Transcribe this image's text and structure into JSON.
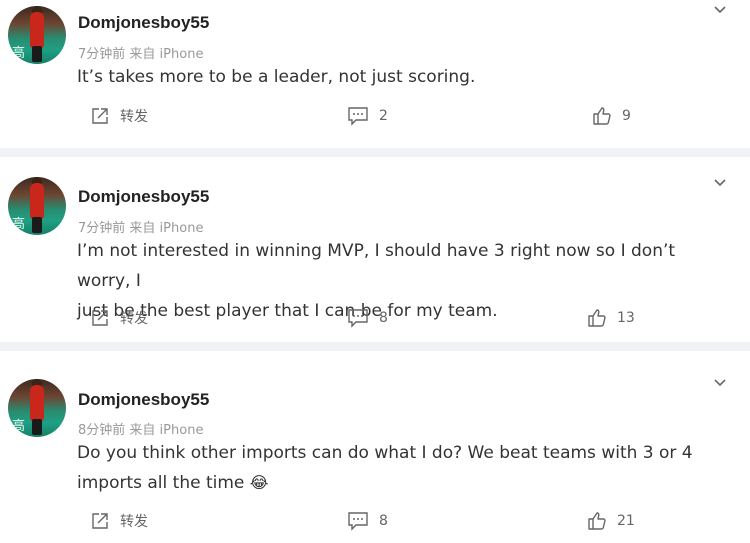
{
  "comments": [
    {
      "username": "Domjonesboy55",
      "time": "7分钟前",
      "source": "来自 iPhone",
      "text_lines": [
        "It’s takes more to be a leader, not just scoring."
      ],
      "repost_label": "转发",
      "comment_count": "2",
      "like_count": "9"
    },
    {
      "username": "Domjonesboy55",
      "time": "7分钟前",
      "source": "来自 iPhone",
      "text_lines": [
        "I’m not interested in winning MVP, I should have 3 right now so I don’t worry, I",
        "just be the best player that I can be for my team."
      ],
      "repost_label": "转发",
      "comment_count": "8",
      "like_count": "13"
    },
    {
      "username": "Domjonesboy55",
      "time": "8分钟前",
      "source": "来自 iPhone",
      "text_lines": [
        "Do you think other imports can do what I do? We beat teams with 3 or 4",
        "imports all the time"
      ],
      "emoji": "😂",
      "repost_label": "转发",
      "comment_count": "8",
      "like_count": "21"
    }
  ],
  "avatar_sign": "高",
  "icons": {
    "repost": "repost-icon",
    "comment": "comment-icon",
    "like": "thumbs-up-icon",
    "more": "chevron-down-icon"
  }
}
